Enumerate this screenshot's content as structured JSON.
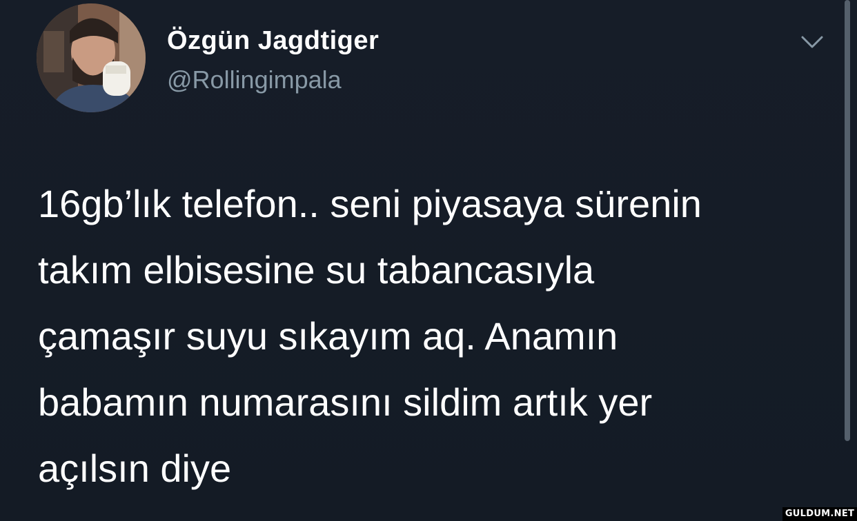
{
  "tweet": {
    "display_name": "Özgün Jagdtiger",
    "handle": "@Rollingimpala",
    "text_lines": [
      "16gb’lık telefon.. seni piyasaya sürenin",
      "takım elbisesine su tabancasıyla",
      "çamaşır suyu sıkayım aq. Anamın",
      "babamın numarasını sildim artık yer",
      "açılsın diye"
    ],
    "menu_icon": "chevron-down-icon",
    "avatar_icon": "profile-photo"
  },
  "watermark": {
    "text": "GULDUM.NET"
  },
  "colors": {
    "background": "#151c26",
    "primary_text": "#ffffff",
    "secondary_text": "#8899a6"
  }
}
